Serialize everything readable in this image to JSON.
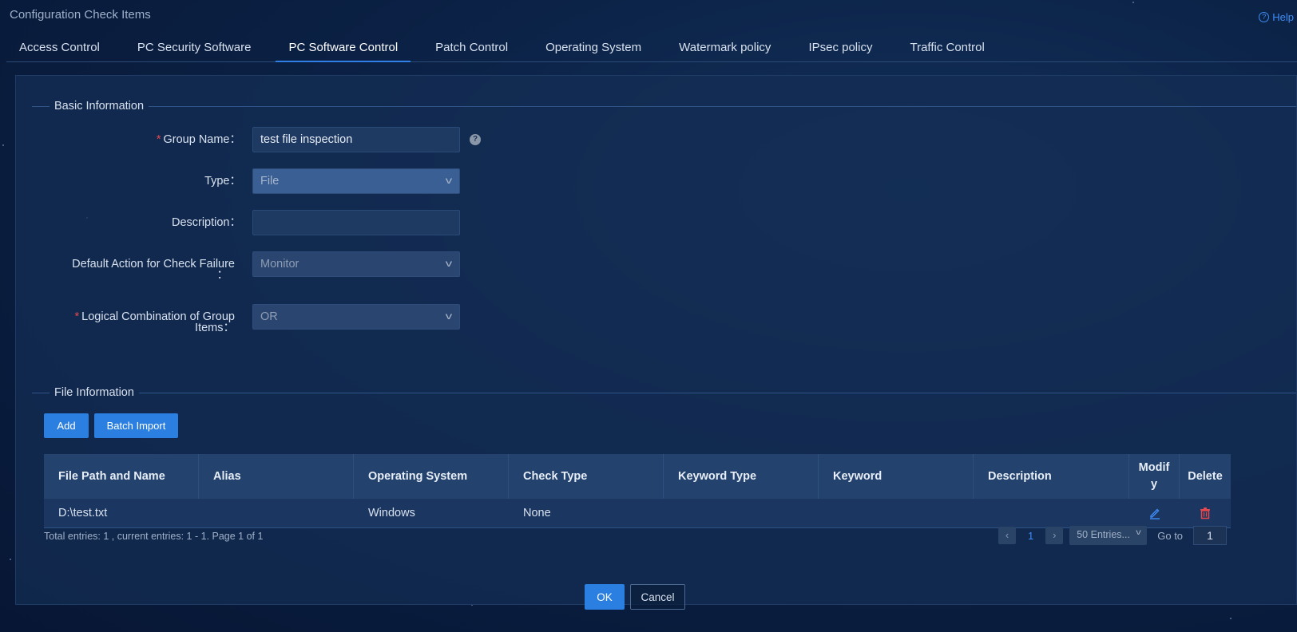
{
  "page": {
    "title": "Configuration Check Items",
    "help_label": "Help"
  },
  "tabs": [
    {
      "label": "Access Control",
      "active": false
    },
    {
      "label": "PC Security Software",
      "active": false
    },
    {
      "label": "PC Software Control",
      "active": true
    },
    {
      "label": "Patch Control",
      "active": false
    },
    {
      "label": "Operating System",
      "active": false
    },
    {
      "label": "Watermark policy",
      "active": false
    },
    {
      "label": "IPsec policy",
      "active": false
    },
    {
      "label": "Traffic Control",
      "active": false
    }
  ],
  "basic_info": {
    "title": "Basic Information",
    "group_name": {
      "label": "Group Name：",
      "value": "test file inspection",
      "required": true
    },
    "type": {
      "label": "Type：",
      "value": "File"
    },
    "description": {
      "label": "Description：",
      "value": ""
    },
    "default_action": {
      "label_line1": "Default Action for Check Failure",
      "label_line2": "：",
      "value": "Monitor"
    },
    "logical_combination": {
      "label_line1": "Logical Combination of Group",
      "label_line2": "Items：",
      "value": "OR",
      "required": true
    }
  },
  "file_info": {
    "title": "File Information",
    "add_label": "Add",
    "batch_import_label": "Batch Import",
    "columns": [
      "File Path and Name",
      "Alias",
      "Operating System",
      "Check Type",
      "Keyword Type",
      "Keyword",
      "Description",
      "Modif",
      "y",
      "Delete"
    ],
    "rows": [
      {
        "path": "D:\\test.txt",
        "alias": "",
        "os": "Windows",
        "check_type": "None",
        "keyword_type": "",
        "keyword": "",
        "description": ""
      }
    ]
  },
  "pagination": {
    "summary": "Total entries: 1 , current entries: 1 - 1. Page 1 of 1",
    "current_page": "1",
    "page_size": "50 Entries...",
    "goto_label": "Go to",
    "goto_value": "1"
  },
  "actions": {
    "ok_label": "OK",
    "cancel_label": "Cancel"
  },
  "colors": {
    "accent": "#2a7fe0",
    "required": "#e5484d",
    "delete": "#e5484d",
    "link": "#3f8cf5"
  }
}
